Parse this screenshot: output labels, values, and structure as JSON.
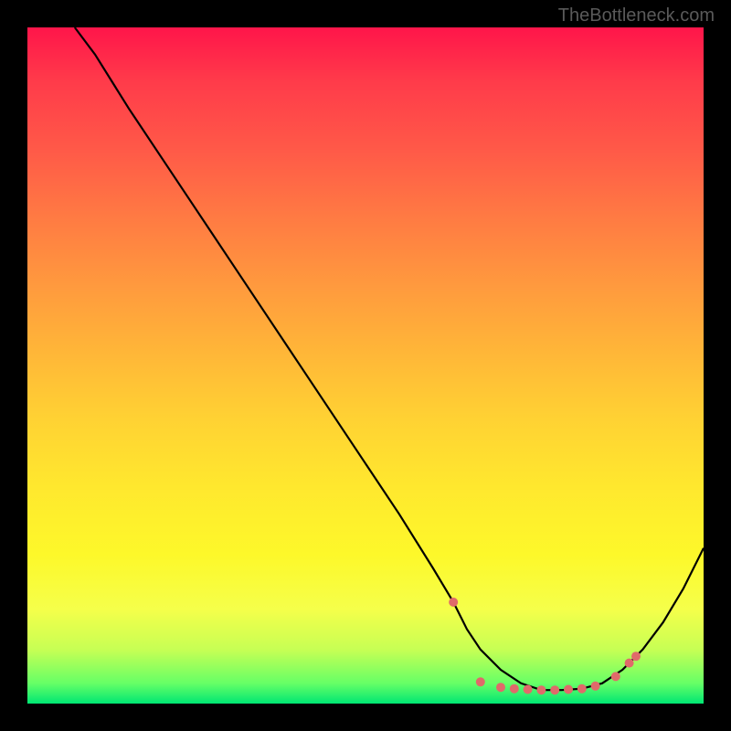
{
  "watermark": "TheBottleneck.com",
  "chart_data": {
    "type": "line",
    "title": "",
    "xlabel": "",
    "ylabel": "",
    "xlim": [
      0,
      100
    ],
    "ylim": [
      0,
      100
    ],
    "series": [
      {
        "name": "curve",
        "color": "#000000",
        "x": [
          7,
          10,
          15,
          20,
          25,
          30,
          35,
          40,
          45,
          50,
          55,
          60,
          63,
          65,
          67,
          70,
          73,
          76,
          79,
          82,
          85,
          88,
          91,
          94,
          97,
          100
        ],
        "y": [
          100,
          96,
          88,
          80.5,
          73,
          65.5,
          58,
          50.5,
          43,
          35.5,
          28,
          20,
          15,
          11,
          8,
          5,
          3,
          2,
          2,
          2.2,
          3,
          5,
          8,
          12,
          17,
          23
        ]
      }
    ],
    "markers": [
      {
        "x": 63,
        "y": 15
      },
      {
        "x": 67,
        "y": 3.2
      },
      {
        "x": 70,
        "y": 2.4
      },
      {
        "x": 72,
        "y": 2.2
      },
      {
        "x": 74,
        "y": 2.1
      },
      {
        "x": 76,
        "y": 2.0
      },
      {
        "x": 78,
        "y": 2.0
      },
      {
        "x": 80,
        "y": 2.1
      },
      {
        "x": 82,
        "y": 2.2
      },
      {
        "x": 84,
        "y": 2.6
      },
      {
        "x": 87,
        "y": 4.0
      },
      {
        "x": 89,
        "y": 6.0
      },
      {
        "x": 90,
        "y": 7.0
      }
    ],
    "marker_color": "#e06a6a",
    "gradient_stops": [
      {
        "pos": 0,
        "color": "#ff154a"
      },
      {
        "pos": 0.5,
        "color": "#ffd233"
      },
      {
        "pos": 0.97,
        "color": "#66ff66"
      },
      {
        "pos": 1.0,
        "color": "#00e673"
      }
    ]
  }
}
